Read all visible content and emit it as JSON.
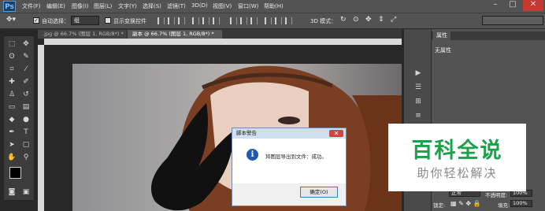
{
  "app": {
    "logo": "Ps"
  },
  "menu": [
    "文件(F)",
    "编辑(E)",
    "图像(I)",
    "图层(L)",
    "文字(Y)",
    "选择(S)",
    "滤镜(T)",
    "3D(D)",
    "视图(V)",
    "窗口(W)",
    "帮助(H)"
  ],
  "options": {
    "auto_select_label": "自动选择：",
    "auto_select_value": "组",
    "transform_label": "显示变换控件",
    "mode_3d_label": "3D 模式："
  },
  "tabs": [
    {
      "label": ".jpg @ 66.7% (图层 1, RGB/8*) *"
    },
    {
      "label": "副本 @ 66.7% (图层 1, RGB/8*) *"
    }
  ],
  "properties": {
    "tab": "属性",
    "title": "无属性"
  },
  "dialog": {
    "title": "脚本警告",
    "message": "将图层导出到文件：成功。",
    "ok_label": "确定(O)",
    "icon": "info-icon"
  },
  "layers": {
    "blend_mode": "正常",
    "opacity_label": "不透明度:",
    "opacity_value": "100%",
    "lock_label": "锁定:",
    "fill_label": "填充:",
    "fill_value": "100%"
  },
  "watermark": {
    "title": "百科全说",
    "subtitle": "助你轻松解决"
  }
}
